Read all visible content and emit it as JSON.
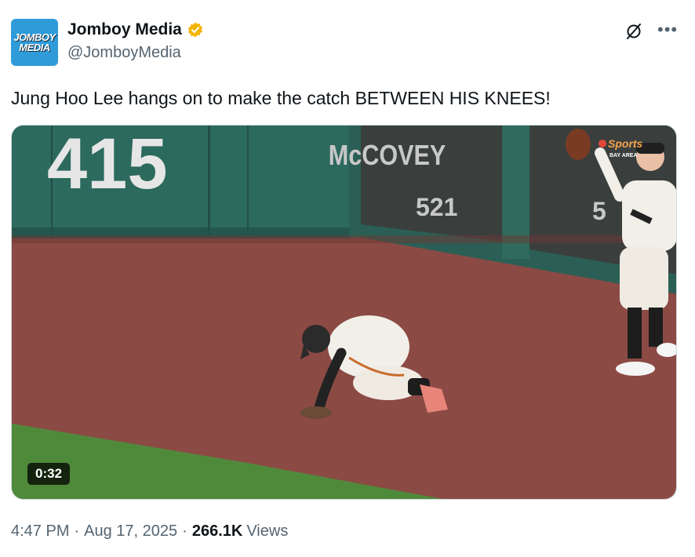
{
  "author": {
    "name": "Jomboy Media",
    "handle": "@JomboyMedia",
    "avatar_text": [
      "JOMBOY",
      "MEDIA"
    ],
    "verified": true
  },
  "tweet": {
    "text": "Jung Hoo Lee hangs on to make the catch BETWEEN HIS KNEES!"
  },
  "media": {
    "type": "video",
    "duration": "0:32",
    "scene_text": {
      "wall_number": "415",
      "sign_name": "McCOVEY",
      "sign_number": "521",
      "sign_partial": "5",
      "broadcaster": "Sports",
      "broadcaster_sub": "BAY AREA"
    }
  },
  "meta": {
    "time": "4:47 PM",
    "date": "Aug 17, 2025",
    "separator": "·",
    "views_count": "266.1K",
    "views_label": "Views"
  },
  "colors": {
    "verified_badge": "#f4b400",
    "avatar_bg": "#2f9bd9",
    "secondary_text": "#536471"
  },
  "icons": [
    "verified-badge-icon",
    "grok-icon",
    "more-icon"
  ]
}
